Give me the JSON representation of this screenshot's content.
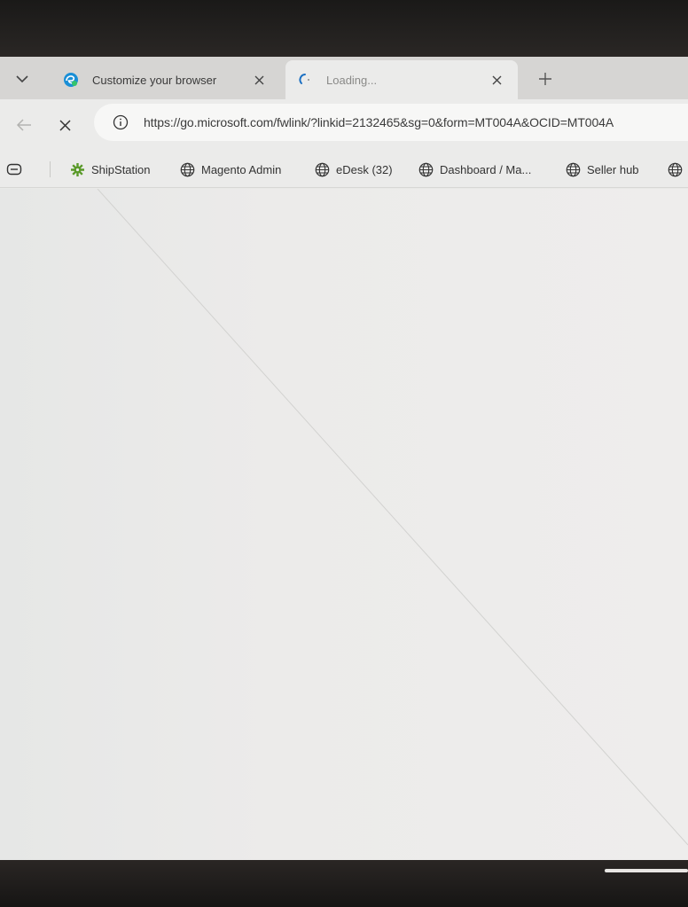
{
  "tabs": [
    {
      "title": "Customize your browser",
      "favicon": "edge-logo-icon",
      "active": false
    },
    {
      "title": "Loading...",
      "favicon": "loading-spinner-icon",
      "active": true
    }
  ],
  "toolbar": {
    "url": "https://go.microsoft.com/fwlink/?linkid=2132465&sg=0&form=MT004A&OCID=MT004A"
  },
  "favorites": [
    {
      "label": "ShipStation",
      "icon": "shipstation-gear-icon"
    },
    {
      "label": "Magento Admin",
      "icon": "globe-icon"
    },
    {
      "label": "eDesk (32)",
      "icon": "globe-icon"
    },
    {
      "label": "Dashboard / Ma...",
      "icon": "globe-icon"
    },
    {
      "label": "Seller hub",
      "icon": "globe-icon"
    }
  ],
  "colors": {
    "accent_green": "#5a9a2a",
    "edge_blue": "#1a8fd6",
    "tabstrip_bg": "#d6d5d3",
    "toolbar_bg": "#ebebea"
  }
}
